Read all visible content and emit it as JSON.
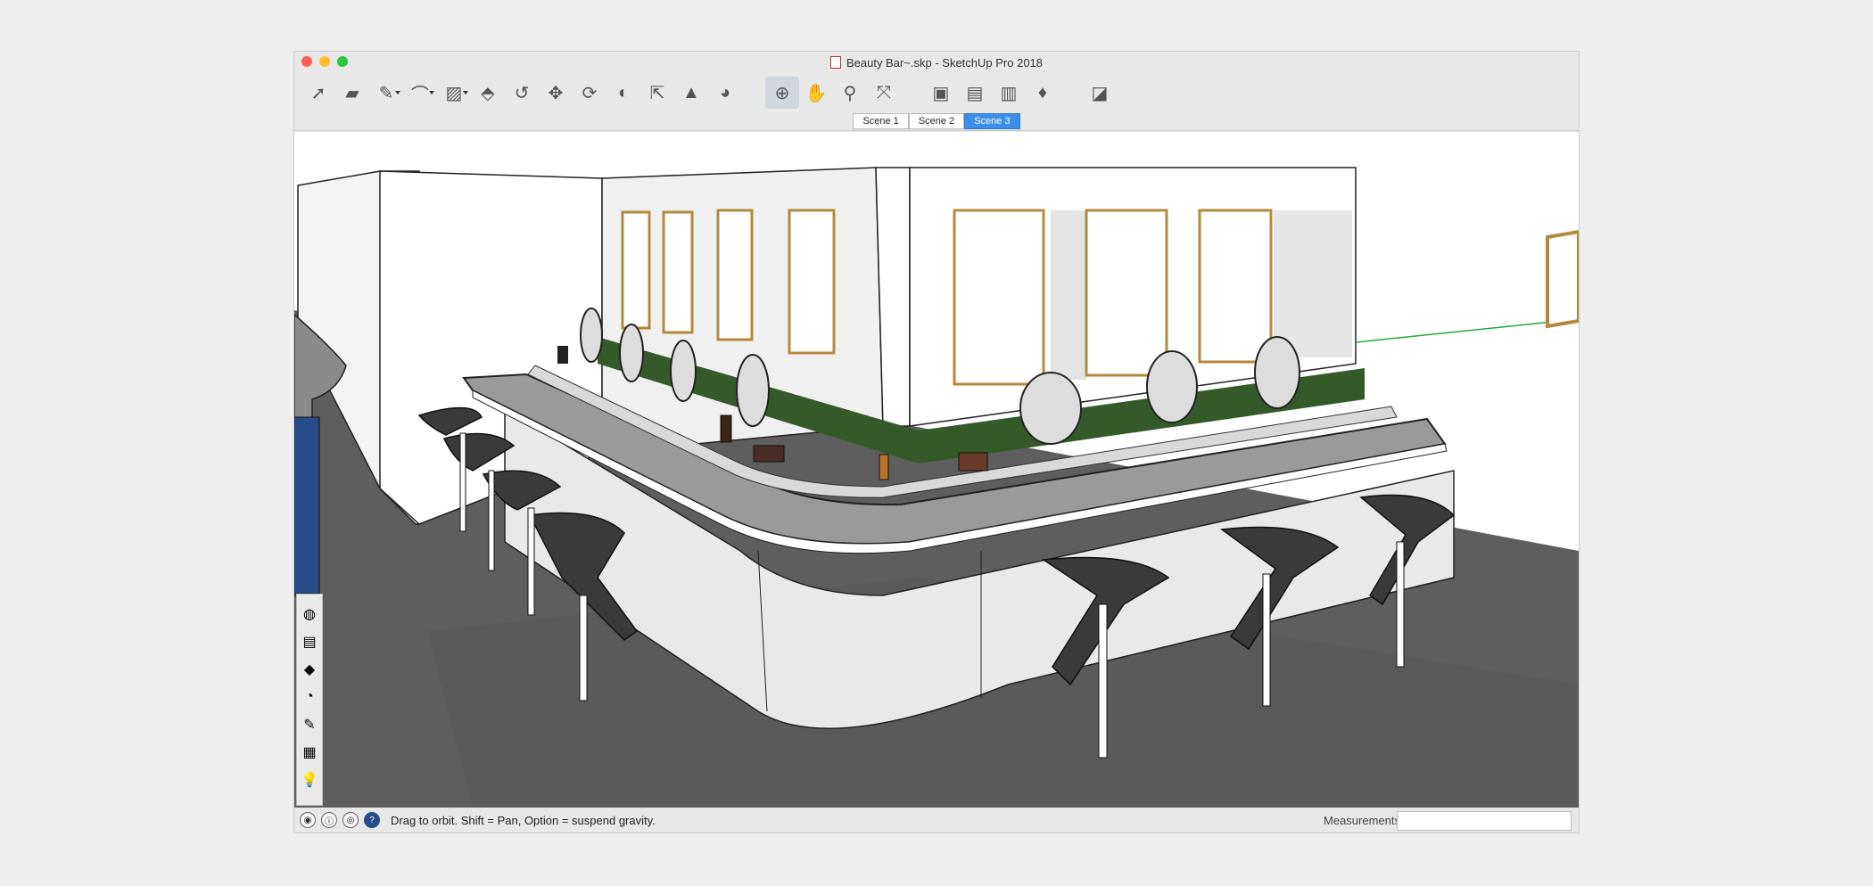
{
  "window": {
    "title": "Beauty Bar~.skp - SketchUp Pro 2018",
    "traffic_colors": {
      "close": "#ff5f57",
      "minimize": "#febc2e",
      "zoom": "#28c840"
    }
  },
  "toolbar": {
    "tools": [
      {
        "name": "select-icon",
        "glyph": "➚"
      },
      {
        "name": "eraser-icon",
        "glyph": "▰"
      },
      {
        "name": "pencil-line-icon",
        "glyph": "✎",
        "dropdown": true
      },
      {
        "name": "arc-icon",
        "glyph": "⌒",
        "dropdown": true
      },
      {
        "name": "rectangle-shape-icon",
        "glyph": "▨",
        "dropdown": true
      },
      {
        "name": "push-pull-icon",
        "glyph": "⬘"
      },
      {
        "name": "offset-icon",
        "glyph": "↺"
      },
      {
        "name": "move-icon",
        "glyph": "✥"
      },
      {
        "name": "rotate-icon",
        "glyph": "⟳"
      },
      {
        "name": "follow-me-icon",
        "glyph": "◐"
      },
      {
        "name": "scale-icon",
        "glyph": "⇱"
      },
      {
        "name": "tape-measure-icon",
        "glyph": "▲"
      },
      {
        "name": "paint-bucket-icon",
        "glyph": "◕"
      },
      {
        "name": "orbit-icon",
        "glyph": "⊕",
        "active": true
      },
      {
        "name": "pan-hand-icon",
        "glyph": "✋"
      },
      {
        "name": "zoom-icon",
        "glyph": "⚲"
      },
      {
        "name": "zoom-extents-icon",
        "glyph": "⤧"
      },
      {
        "name": "warehouse-icon",
        "glyph": "▣"
      },
      {
        "name": "extension-warehouse-icon",
        "glyph": "▤"
      },
      {
        "name": "send-to-layout-icon",
        "glyph": "▥"
      },
      {
        "name": "ruby-console-icon",
        "glyph": "♦"
      },
      {
        "name": "eraser-tray-icon",
        "glyph": "◪"
      }
    ]
  },
  "scenes": {
    "tabs": [
      "Scene 1",
      "Scene 2",
      "Scene 3"
    ],
    "selected": "Scene 3"
  },
  "tray": {
    "icons": [
      "styles-icon",
      "layers-icon",
      "materials-icon",
      "shadows-icon",
      "instructor-icon",
      "components-icon",
      "tips-icon"
    ]
  },
  "status": {
    "message": "Drag to orbit. Shift = Pan, Option = suspend gravity.",
    "measurements_label": "Measurements",
    "measurements_value": ""
  },
  "colors": {
    "accent": "#3d8ee8",
    "floor": "#5d5d5d",
    "counter_top": "#9a9a9a",
    "marble": "#e6e6e6",
    "stool": "#3a3a3a",
    "green_axis": "#1faa3b"
  }
}
